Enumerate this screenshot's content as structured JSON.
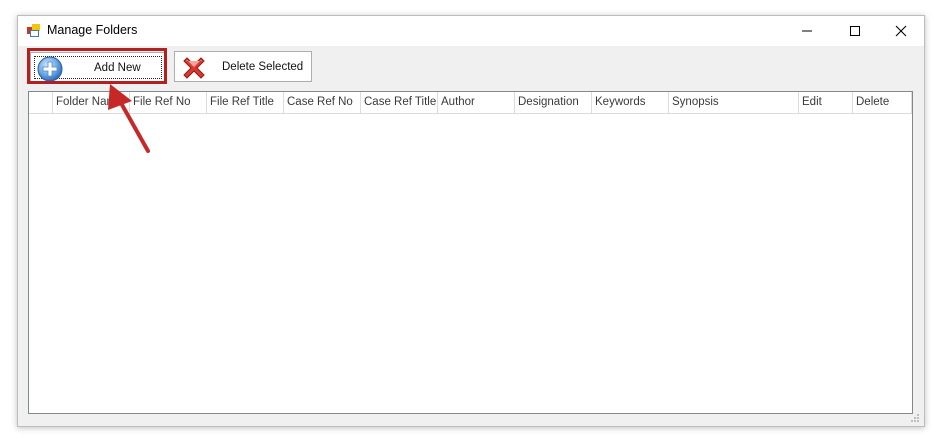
{
  "window": {
    "title": "Manage Folders",
    "icon": "folder-app-icon"
  },
  "toolbar": {
    "add_new_label": "Add New",
    "add_new_icon": "plus-circle-icon",
    "delete_selected_label": "Delete Selected",
    "delete_selected_icon": "red-x-icon"
  },
  "grid": {
    "columns": [
      "Folder Name",
      "File Ref No",
      "File Ref Title",
      "Case Ref No",
      "Case Ref Title",
      "Author",
      "Designation",
      "Keywords",
      "Synopsis",
      "Edit",
      "Delete"
    ],
    "rows": []
  },
  "annotation": {
    "highlight_color": "#b3201f",
    "target": "Add New"
  }
}
